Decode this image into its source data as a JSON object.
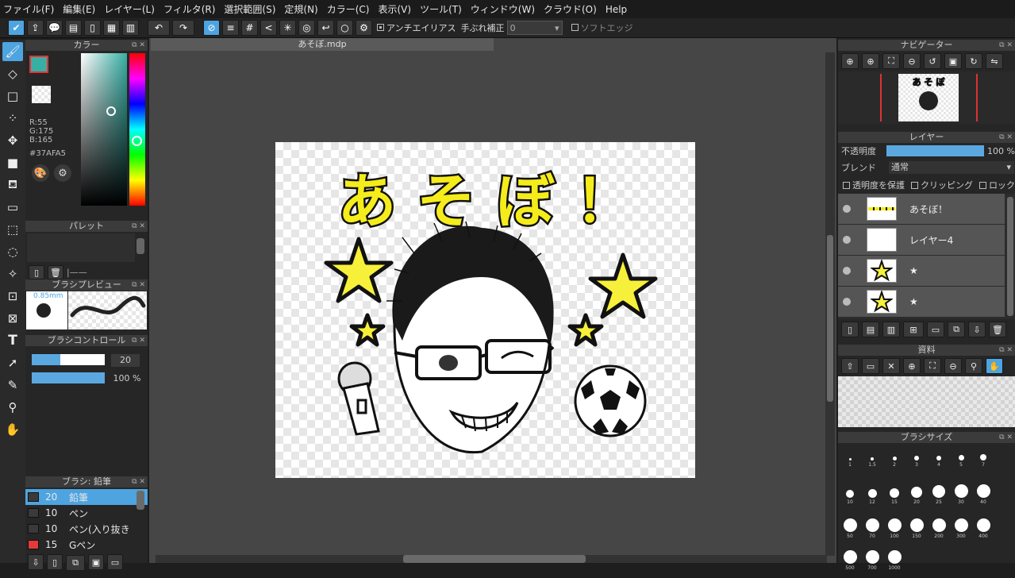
{
  "menu": [
    "ファイル(F)",
    "編集(E)",
    "レイヤー(L)",
    "フィルタ(R)",
    "選択範囲(S)",
    "定規(N)",
    "カラー(C)",
    "表示(V)",
    "ツール(T)",
    "ウィンドウ(W)",
    "クラウド(O)",
    "Help"
  ],
  "toolbar": {
    "antialias_label": "アンチエイリアス",
    "stabilizer_label": "手ぶれ補正",
    "stabilizer_value": "0",
    "softedge_label": "ソフトエッジ"
  },
  "document": {
    "tab_title": "あそぼ.mdp"
  },
  "color_panel": {
    "title": "カラー",
    "r": "R:55",
    "g": "G:175",
    "b": "B:165",
    "hex": "#37AFA5",
    "fg_color": "#37AFA5",
    "bg_color": "#000000"
  },
  "palette_panel": {
    "title": "パレット"
  },
  "brush_preview_panel": {
    "title": "ブラシプレビュー",
    "size_label": "0.85mm"
  },
  "brush_control_panel": {
    "title": "ブラシコントロール",
    "size_value": "20",
    "opacity_value": "100 %"
  },
  "brush_list_panel": {
    "title": "ブラシ: 鉛筆",
    "items": [
      {
        "size": "20",
        "name": "鉛筆",
        "color": "#3a3a3a",
        "selected": true
      },
      {
        "size": "10",
        "name": "ペン",
        "color": "#3a3a3a",
        "selected": false
      },
      {
        "size": "10",
        "name": "ペン(入り抜き",
        "color": "#3a3a3a",
        "selected": false
      },
      {
        "size": "15",
        "name": "Gペン",
        "color": "#e53a3a",
        "selected": false
      }
    ]
  },
  "navigator_panel": {
    "title": "ナビゲーター"
  },
  "layer_panel": {
    "title": "レイヤー",
    "opacity_label": "不透明度",
    "opacity_value": "100 %",
    "blend_label": "ブレンド",
    "blend_value": "通常",
    "protect_label": "透明度を保護",
    "clipping_label": "クリッピング",
    "lock_label": "ロック",
    "layers": [
      {
        "name": "あそぼ！"
      },
      {
        "name": "レイヤー4"
      },
      {
        "name": "★"
      },
      {
        "name": "★"
      }
    ]
  },
  "material_panel": {
    "title": "資料"
  },
  "brush_size_panel": {
    "title": "ブラシサイズ",
    "sizes": [
      "1",
      "1.5",
      "2",
      "3",
      "4",
      "5",
      "7",
      "10",
      "12",
      "15",
      "20",
      "25",
      "30",
      "40",
      "50",
      "70",
      "100",
      "150",
      "200",
      "300",
      "400",
      "500",
      "700",
      "1000"
    ]
  },
  "canvas_art": {
    "title_text": "あ そ ぼ ！"
  }
}
